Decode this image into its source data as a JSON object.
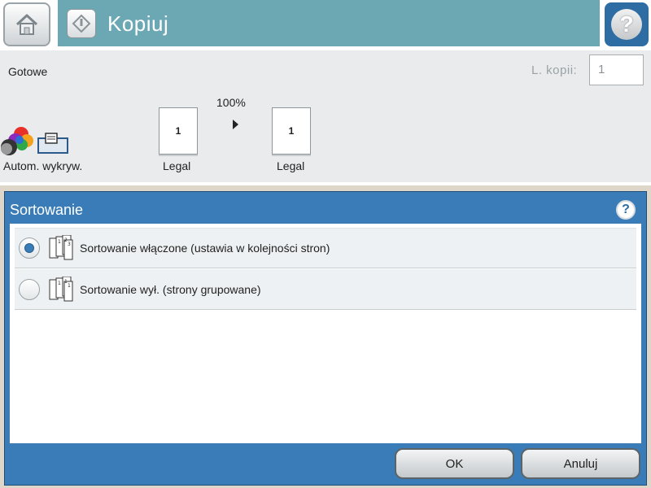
{
  "header": {
    "title": "Kopiuj",
    "home_icon": "home-icon",
    "start_icon": "start-icon",
    "help_icon": "help-icon",
    "help_glyph": "?"
  },
  "status": {
    "text": "Gotowe",
    "copies_label": "L. kopii:",
    "copies_value": "1"
  },
  "preview": {
    "color_mode_label": "Autom. wykryw.",
    "zoom": "100%",
    "original": {
      "page_number": "1",
      "size": "Legal"
    },
    "output": {
      "page_number": "1",
      "size": "Legal"
    }
  },
  "dialog": {
    "title": "Sortowanie",
    "help_glyph": "?",
    "options": [
      {
        "label": "Sortowanie włączone (ustawia w kolejności stron)",
        "selected": true
      },
      {
        "label": "Sortowanie wył. (strony grupowane)",
        "selected": false
      }
    ],
    "ok_label": "OK",
    "cancel_label": "Anuluj"
  },
  "colors": {
    "title_bar": "#6ba8b4",
    "dialog_header": "#3a7cb7",
    "help_button": "#2e6da4",
    "status_bg": "#e9ebec"
  }
}
